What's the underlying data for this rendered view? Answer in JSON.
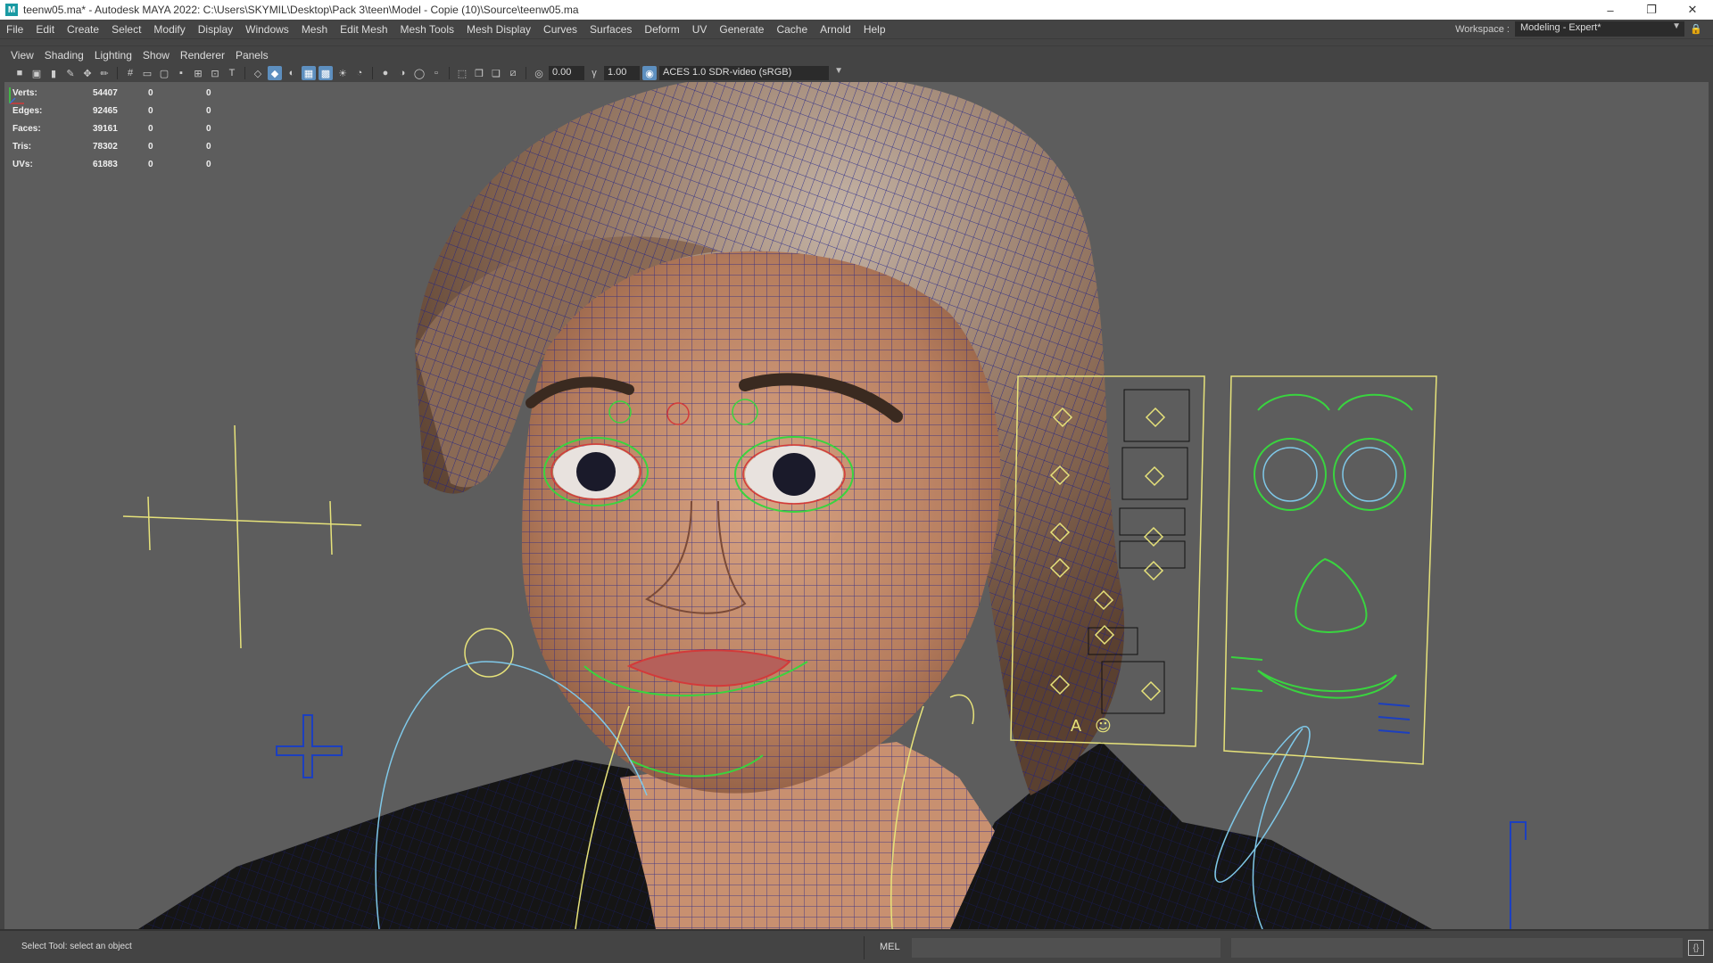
{
  "window": {
    "title": "teenw05.ma* - Autodesk MAYA 2022: C:\\Users\\SKYMIL\\Desktop\\Pack 3\\teen\\Model - Copie (10)\\Source\\teenw05.ma",
    "app_icon": "M",
    "controls": [
      "–",
      "❐",
      "✕"
    ]
  },
  "menu": {
    "items": [
      "File",
      "Edit",
      "Create",
      "Select",
      "Modify",
      "Display",
      "Windows",
      "Mesh",
      "Edit Mesh",
      "Mesh Tools",
      "Mesh Display",
      "Curves",
      "Surfaces",
      "Deform",
      "UV",
      "Generate",
      "Cache",
      "Arnold",
      "Help"
    ]
  },
  "workspace": {
    "label": "Workspace :",
    "value": "Modeling - Expert*"
  },
  "panel_menu": {
    "items": [
      "View",
      "Shading",
      "Lighting",
      "Show",
      "Renderer",
      "Panels"
    ]
  },
  "viewport_toolbar": {
    "exposure": "0.00",
    "gamma": "1.00",
    "color_space": "ACES 1.0 SDR-video (sRGB)"
  },
  "hud": {
    "rows": [
      {
        "label": "Verts:",
        "total": "54407",
        "selected": "0",
        "sel_comp": "0"
      },
      {
        "label": "Edges:",
        "total": "92465",
        "selected": "0",
        "sel_comp": "0"
      },
      {
        "label": "Faces:",
        "total": "39161",
        "selected": "0",
        "sel_comp": "0"
      },
      {
        "label": "Tris:",
        "total": "78302",
        "selected": "0",
        "sel_comp": "0"
      },
      {
        "label": "UVs:",
        "total": "61883",
        "selected": "0",
        "sel_comp": "0"
      }
    ]
  },
  "viewport": {
    "camera": "persp",
    "panel_letter": "A",
    "colors": {
      "background": "#5d5d5d",
      "wireframe": "#1c1f8a",
      "control_yellow": "#e6e27a",
      "control_green": "#39d43f",
      "control_cyan": "#7fc8e8",
      "control_red": "#d33a3a",
      "skin": "#c89070",
      "hair": "#7a5a44",
      "shirt": "#111111"
    }
  },
  "status": {
    "help_line": "Select Tool: select an object",
    "mel_label": "MEL"
  }
}
